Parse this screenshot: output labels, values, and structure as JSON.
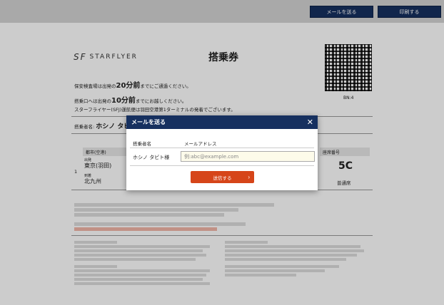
{
  "toolbar": {
    "send_mail_label": "メールを送る",
    "print_label": "印刷する"
  },
  "ticket": {
    "logo_text": "STARFLYER",
    "logo_mark": "SF",
    "title": "搭乗券",
    "qr_label": "BN:4",
    "security_pre": "保安検査場は出発の",
    "security_time": "20分前",
    "security_post": "までにご通過ください。",
    "gate_pre": "搭乗口へは出発の",
    "gate_time": "10分前",
    "gate_post": "までにお越しください。",
    "terminal_note": "スターフライヤー(SFJ)運航便は羽田空港第1ターミナルの発着でございます。",
    "passenger_label": "搭乗者名:",
    "passenger_name": "ホシノ タビト",
    "col_route": "都市(空港)",
    "col_seat": "座席番号",
    "dep_label": "出発",
    "dep_city": "東京(羽田)",
    "arr_label": "到着",
    "arr_city": "北九州",
    "seat": "5C",
    "seat_class": "普通席",
    "row_marker": "1"
  },
  "modal": {
    "title": "メールを送る",
    "close_glyph": "✕",
    "hdr_name": "搭乗者名",
    "hdr_mail": "メールアドレス",
    "passenger": "ホシノ タビト様",
    "email_placeholder": "例:abc@example.com",
    "email_value": "",
    "send_label": "送信する",
    "send_chevron": "›"
  }
}
